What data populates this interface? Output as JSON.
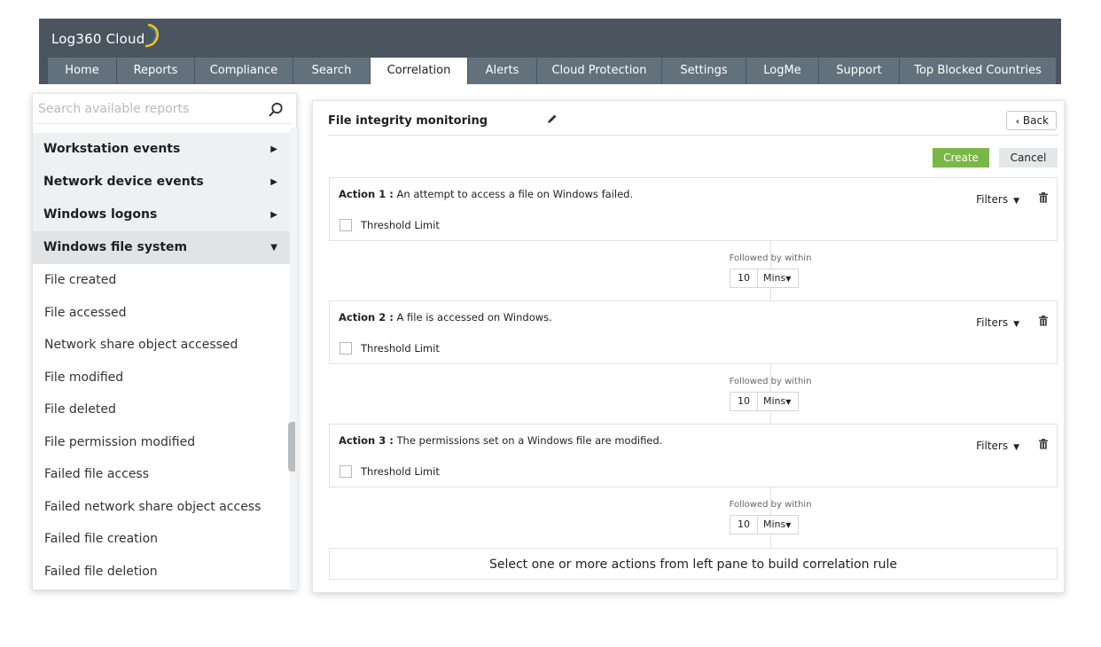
{
  "app": {
    "logo_text": "Log360 Cloud"
  },
  "nav": {
    "tabs": [
      {
        "label": "Home"
      },
      {
        "label": "Reports"
      },
      {
        "label": "Compliance"
      },
      {
        "label": "Search"
      },
      {
        "label": "Correlation",
        "active": true
      },
      {
        "label": "Alerts"
      },
      {
        "label": "Cloud Protection"
      },
      {
        "label": "Settings"
      },
      {
        "label": "LogMe"
      },
      {
        "label": "Support"
      },
      {
        "label": "Top Blocked Countries"
      }
    ]
  },
  "sidebar": {
    "search_placeholder": "Search available reports",
    "categories": [
      {
        "label": "Workstation events",
        "expanded": false
      },
      {
        "label": "Network device events",
        "expanded": false
      },
      {
        "label": "Windows logons",
        "expanded": false
      },
      {
        "label": "Windows file system",
        "expanded": true
      }
    ],
    "sub_items": [
      "File created",
      "File accessed",
      "Network share object accessed",
      "File modified",
      "File deleted",
      "File permission modified",
      "Failed file access",
      "Failed network share object access",
      "Failed file creation",
      "Failed file deletion"
    ]
  },
  "main": {
    "rule_title": "File integrity monitoring",
    "back_label": "Back",
    "create_label": "Create",
    "cancel_label": "Cancel",
    "filters_label": "Filters",
    "threshold_label": "Threshold Limit",
    "followed_label": "Followed by within",
    "actions": [
      {
        "prefix": "Action 1 :",
        "description": "An attempt to access a file on Windows failed.",
        "within_value": "10",
        "within_unit": "Mins"
      },
      {
        "prefix": "Action 2 :",
        "description": "A file is accessed on Windows.",
        "within_value": "10",
        "within_unit": "Mins"
      },
      {
        "prefix": "Action 3 :",
        "description": "The permissions set on a Windows file are modified.",
        "within_value": "10",
        "within_unit": "Mins"
      }
    ],
    "hint": "Select one or more actions from left pane to build correlation rule"
  },
  "colors": {
    "header_bg": "#4a5560",
    "tab_bg": "#63717c",
    "create_green": "#7ab648"
  }
}
